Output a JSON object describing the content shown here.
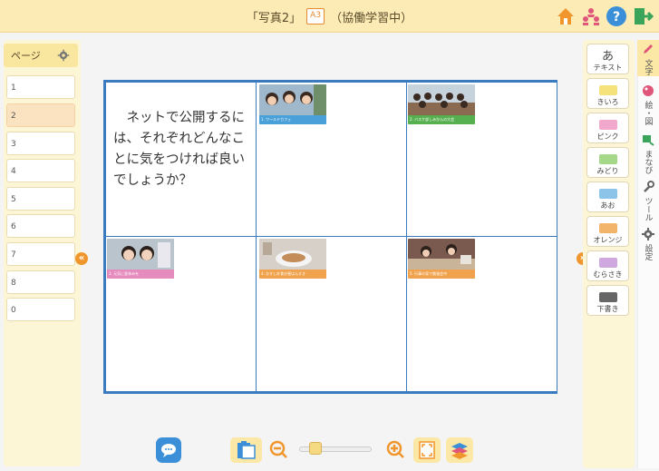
{
  "header": {
    "title": "「写真2」",
    "size_badge": "A3",
    "status": "（協働学習中）"
  },
  "pages_panel": {
    "label": "ページ",
    "items": [
      "1",
      "2",
      "3",
      "4",
      "5",
      "6",
      "7",
      "8",
      "0"
    ],
    "selected_index": 1
  },
  "canvas": {
    "question": "ネットで公開するには、それぞれどんなことに気をつければ良いでしょうか？",
    "photos": [
      {
        "caption": "1. ワールドカフェ",
        "color": "#4aa0d8"
      },
      {
        "caption": "2. バスケ部しみかんの大会",
        "color": "#57b04f"
      },
      {
        "caption": "3. 元気に夏休みを",
        "color": "#e58bbd"
      },
      {
        "caption": "4. おすし外食お昼はんすき",
        "color": "#f0a24d"
      },
      {
        "caption": "5. 行事の家で勉強会中",
        "color": "#f0a24d"
      }
    ]
  },
  "palette": {
    "text_button": "テキスト",
    "text_glyph": "あ",
    "items": [
      {
        "label": "きいろ",
        "color": "#f6e27a"
      },
      {
        "label": "ピンク",
        "color": "#f1a8cc"
      },
      {
        "label": "みどり",
        "color": "#a6d88a"
      },
      {
        "label": "あお",
        "color": "#8cc3e8"
      },
      {
        "label": "オレンジ",
        "color": "#f2b36a"
      },
      {
        "label": "むらさき",
        "color": "#d0a8e0"
      },
      {
        "label": "下書き",
        "color": "#666666"
      }
    ]
  },
  "side_tabs": [
    "文字",
    "絵・図",
    "まなび",
    "ツール",
    "設定"
  ],
  "colors": {
    "accent_orange": "#f0962d",
    "grid_blue": "#3a7bbf",
    "header_yellow": "#fcebb5"
  }
}
